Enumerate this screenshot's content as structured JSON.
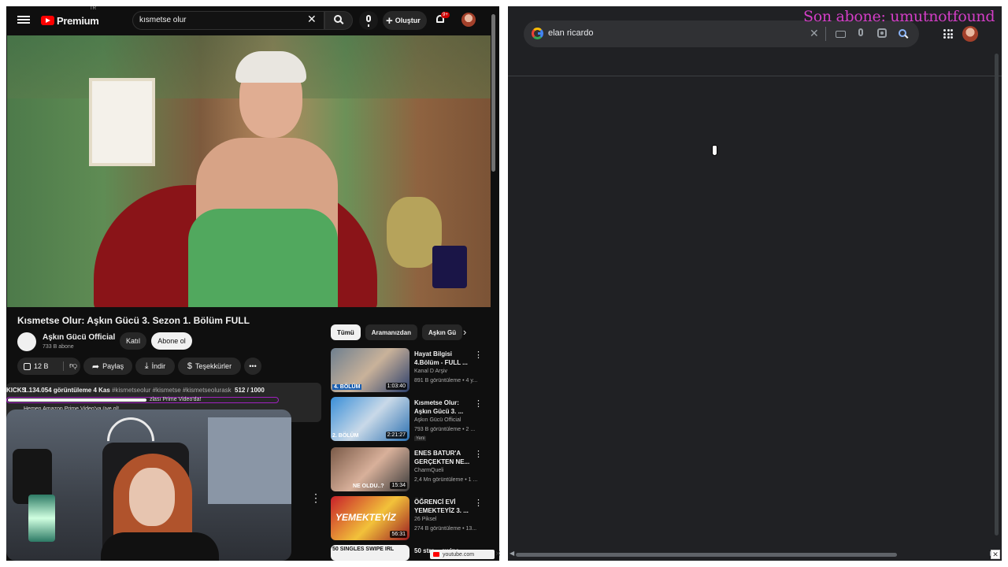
{
  "youtube": {
    "logo_text": "Premium",
    "region": "TR",
    "search_value": "kısmetse olur",
    "create_label": "Oluştur",
    "notif_badge": "9+",
    "video": {
      "title": "Kısmetse Olur: Aşkın Gücü 3. Sezon 1. Bölüm FULL",
      "channel": "Aşkın Gücü Official",
      "subs": "733 B abone",
      "join": "Katıl",
      "subscribe": "Abone ol",
      "likes": "12 B",
      "share": "Paylaş",
      "download": "İndir",
      "thanks": "Teşekkürler",
      "views": "1.134.054 görüntüleme  4 Kas",
      "tags": "#kismetseolur #kismetse #kismetseolurask",
      "kicks": "KICKS",
      "counter": "512 / 1000",
      "desc_line2": "zlası Prime Video'da!",
      "desc_line3": "Hemen Amazon Prime Video'ya üye ol!"
    },
    "chips": [
      "Tümü",
      "Aramanızdan",
      "Aşkın Gü"
    ],
    "related": [
      {
        "title": "Hayat Bilgisi 4.Bölüm - FULL ...",
        "channel": "Kanal D Arşiv",
        "meta": "891 B görüntüleme • 4 y...",
        "duration": "1:03:40",
        "thumb_label": "4. BÖLÜM",
        "new": ""
      },
      {
        "title": "Kısmetse Olur: Aşkın Gücü 3. ...",
        "channel": "Aşkın Gücü Official",
        "meta": "793 B görüntüleme • 2 ...",
        "duration": "2:21:27",
        "thumb_label": "2. BÖLÜM",
        "new": "Yeni"
      },
      {
        "title": "ENES BATUR'A GERÇEKTEN NE...",
        "channel": "CharmQueli",
        "meta": "2,4 Mn görüntüleme • 1 ...",
        "duration": "15:34",
        "thumb_label": "NE OLDU..?",
        "new": ""
      },
      {
        "title": "ÖĞRENCİ EVİ YEMEKTEYİZ 3. ...",
        "channel": "26 Piksel",
        "meta": "274 B görüntüleme • 13...",
        "duration": "56:31",
        "thumb_label": "YEMEKTEYİZ",
        "new": ""
      },
      {
        "title": "50 stra... swipe...",
        "channel": "",
        "meta": "",
        "duration": "",
        "thumb_label": "50 SINGLES SWIPE IRL",
        "new": ""
      }
    ],
    "badge": "youtube.com"
  },
  "google": {
    "search_value": "elan ricardo"
  },
  "overlay": {
    "text": "Son abone: umutnotfound"
  }
}
